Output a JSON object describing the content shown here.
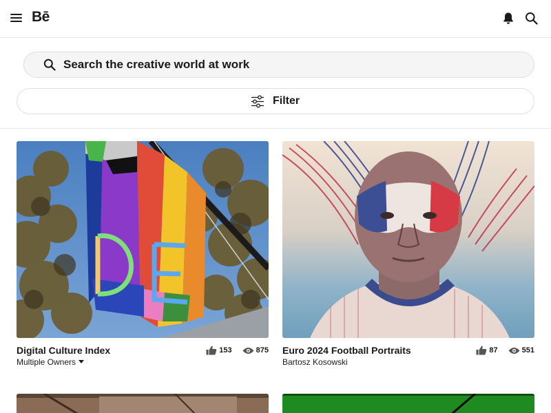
{
  "header": {
    "logo": "Bē",
    "icons": [
      "hamburger-icon",
      "bell-icon",
      "search-icon"
    ]
  },
  "search": {
    "placeholder": "Search the creative world at work",
    "value": ""
  },
  "filter": {
    "label": "Filter"
  },
  "projects": [
    {
      "title": "Digital Culture Index",
      "owner": "Multiple Owners",
      "owner_has_dropdown": true,
      "appreciations": "153",
      "views": "875"
    },
    {
      "title": "Euro 2024 Football Portraits",
      "owner": "Bartosz Kosowski",
      "owner_has_dropdown": false,
      "appreciations": "87",
      "views": "551"
    }
  ],
  "colors": {
    "text": "#191919",
    "stat_icon": "#555555",
    "border": "#dedede",
    "search_bg": "#f5f5f5"
  }
}
